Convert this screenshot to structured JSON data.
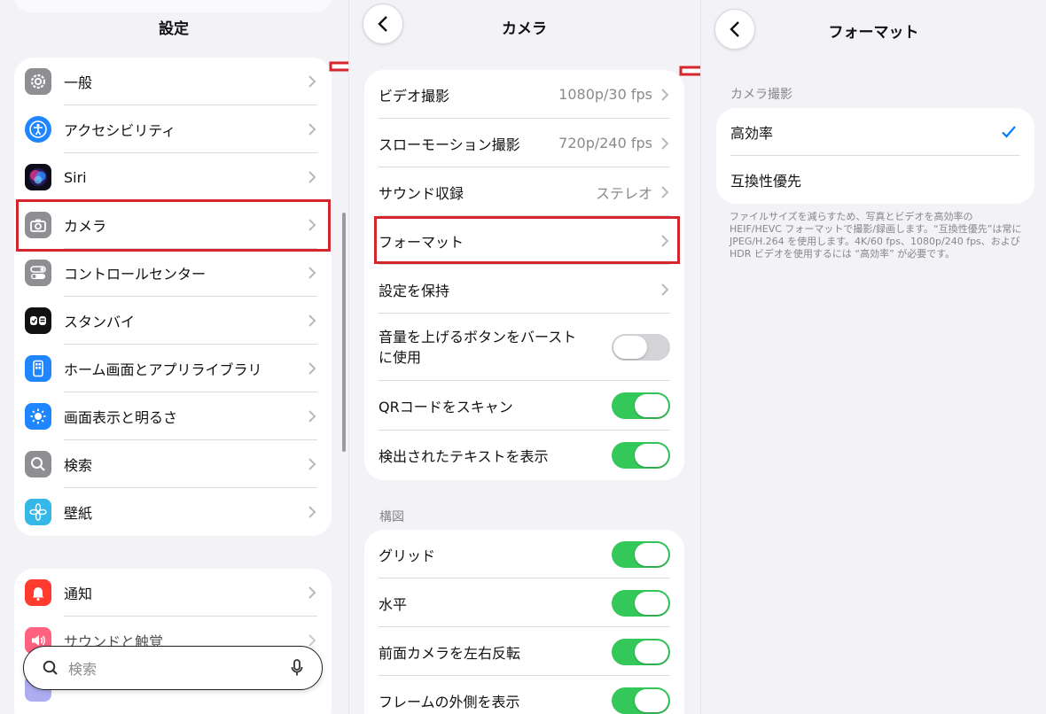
{
  "panel1": {
    "title": "設定",
    "card1": [
      {
        "label": "一般",
        "icon": "gear-icon",
        "color": "#8e8e93"
      },
      {
        "label": "アクセシビリティ",
        "icon": "accessibility-icon",
        "color": "#1f86ff"
      },
      {
        "label": "Siri",
        "icon": "siri-icon",
        "color": "#1a1a2e"
      },
      {
        "label": "カメラ",
        "icon": "camera-icon",
        "color": "#8e8e93"
      },
      {
        "label": "コントロールセンター",
        "icon": "control-center-icon",
        "color": "#8e8e93"
      },
      {
        "label": "スタンバイ",
        "icon": "standby-icon",
        "color": "#111111"
      },
      {
        "label": "ホーム画面とアプリライブラリ",
        "icon": "home-screen-icon",
        "color": "#1f86ff"
      },
      {
        "label": "画面表示と明るさ",
        "icon": "brightness-icon",
        "color": "#1f86ff"
      },
      {
        "label": "検索",
        "icon": "search-icon",
        "color": "#8e8e93"
      },
      {
        "label": "壁紙",
        "icon": "wallpaper-icon",
        "color": "#35b8e8"
      }
    ],
    "card2": [
      {
        "label": "通知",
        "icon": "notification-icon",
        "color": "#ff3b30"
      },
      {
        "label": "サウンドと触覚",
        "icon": "sound-icon",
        "color": "#ff2d55"
      }
    ],
    "search_placeholder": "検索"
  },
  "panel2": {
    "title": "カメラ",
    "card1": [
      {
        "label": "ビデオ撮影",
        "value": "1080p/30 fps"
      },
      {
        "label": "スローモーション撮影",
        "value": "720p/240 fps"
      },
      {
        "label": "サウンド収録",
        "value": "ステレオ"
      },
      {
        "label": "フォーマット",
        "value": ""
      },
      {
        "label": "設定を保持",
        "value": ""
      }
    ],
    "toggles1": [
      {
        "label_line1": "音量を上げるボタンをバースト",
        "label_line2": "に使用",
        "on": false
      },
      {
        "label_line1": "QRコードをスキャン",
        "label_line2": "",
        "on": true
      },
      {
        "label_line1": "検出されたテキストを表示",
        "label_line2": "",
        "on": true
      }
    ],
    "section_composition": "構図",
    "toggles2": [
      {
        "label": "グリッド",
        "on": true
      },
      {
        "label": "水平",
        "on": true
      },
      {
        "label": "前面カメラを左右反転",
        "on": true
      },
      {
        "label": "フレームの外側を表示",
        "on": true
      }
    ]
  },
  "panel3": {
    "title": "フォーマット",
    "section_camera_capture": "カメラ撮影",
    "options": [
      {
        "label": "高効率",
        "selected": true
      },
      {
        "label": "互換性優先",
        "selected": false
      }
    ],
    "footnote": "ファイルサイズを減らすため、写真とビデオを高効率のHEIF/HEVC フォーマットで撮影/録画します。“互換性優先”は常にJPEG/H.264 を使用します。4K/60 fps、1080p/240 fps、およびHDR ビデオを使用するには “高効率” が必要です。"
  },
  "colors": {
    "accent": "#007aff",
    "toggle_on": "#34c759",
    "highlight": "#d6262d"
  }
}
